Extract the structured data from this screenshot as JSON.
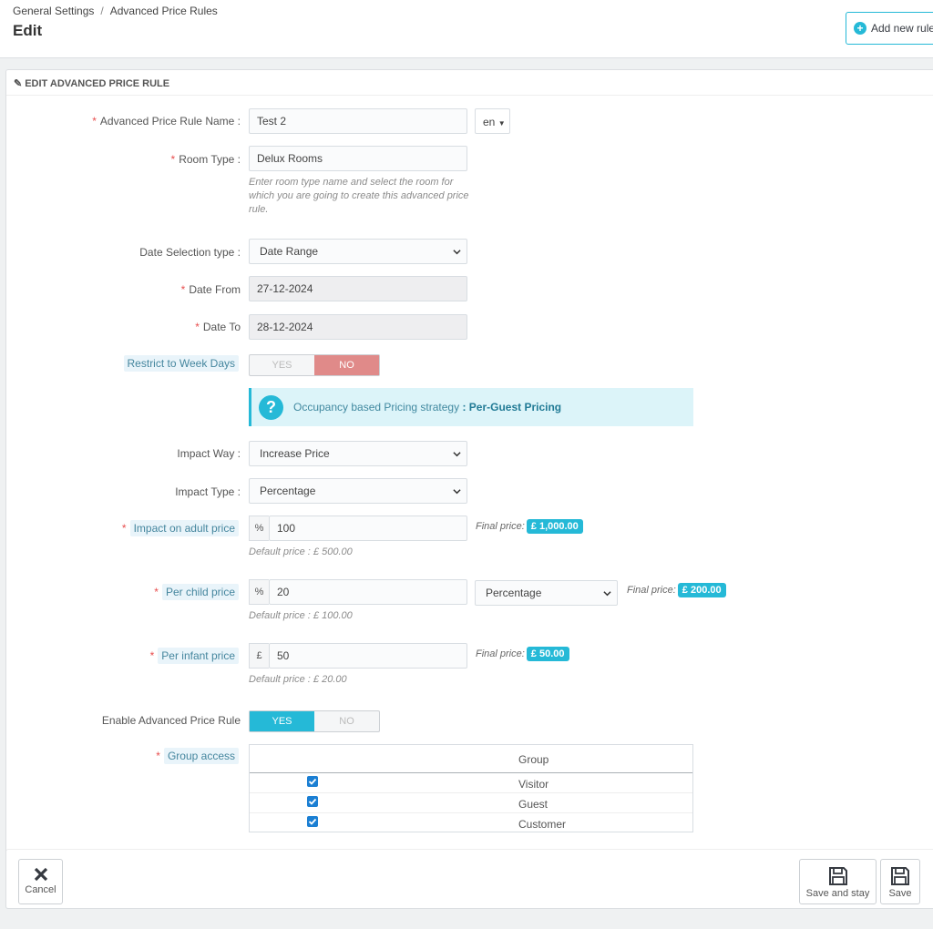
{
  "header": {
    "breadcrumb": [
      "General Settings",
      "Advanced Price Rules"
    ],
    "breadcrumb_sep": "/",
    "title": "Edit",
    "add_new_label": "Add new rule"
  },
  "panel": {
    "heading": "EDIT ADVANCED PRICE RULE"
  },
  "form": {
    "name_label": "Advanced Price Rule Name :",
    "name_value": "Test 2",
    "lang": "en",
    "room_type_label": "Room Type :",
    "room_type_value": "Delux Rooms",
    "room_type_help": "Enter room type name and select the room for which you are going to create this advanced price rule.",
    "date_selection_label": "Date Selection type :",
    "date_selection_value": "Date Range",
    "date_from_label": "Date From",
    "date_from_value": "27-12-2024",
    "date_to_label": "Date To",
    "date_to_value": "28-12-2024",
    "restrict_label": "Restrict to Week Days",
    "restrict_yes": "YES",
    "restrict_no": "NO",
    "info_text": "Occupancy based Pricing strategy",
    "info_value": ": Per-Guest Pricing",
    "impact_way_label": "Impact Way :",
    "impact_way_value": "Increase Price",
    "impact_type_label": "Impact Type :",
    "impact_type_value": "Percentage",
    "adult_label": "Impact on adult price",
    "adult_prefix": "%",
    "adult_value": "100",
    "adult_final_label": "Final price:",
    "adult_final": "£ 1,000.00",
    "adult_default": "Default price : £ 500.00",
    "child_label": "Per child price",
    "child_prefix": "%",
    "child_value": "20",
    "child_type": "Percentage",
    "child_final_label": "Final price:",
    "child_final": "£ 200.00",
    "child_default": "Default price : £ 100.00",
    "infant_label": "Per infant price",
    "infant_prefix": "£",
    "infant_value": "50",
    "infant_final_label": "Final price:",
    "infant_final": "£ 50.00",
    "infant_default": "Default price : £ 20.00",
    "enable_label": "Enable Advanced Price Rule",
    "enable_yes": "YES",
    "enable_no": "NO",
    "group_label": "Group access",
    "group_header": "Group",
    "groups": [
      "Visitor",
      "Guest",
      "Customer"
    ]
  },
  "footer": {
    "cancel": "Cancel",
    "save_stay": "Save and stay",
    "save": "Save"
  },
  "colors": {
    "accent": "#25b9d7",
    "required": "#e84e4e",
    "no_active": "#e08a89"
  }
}
